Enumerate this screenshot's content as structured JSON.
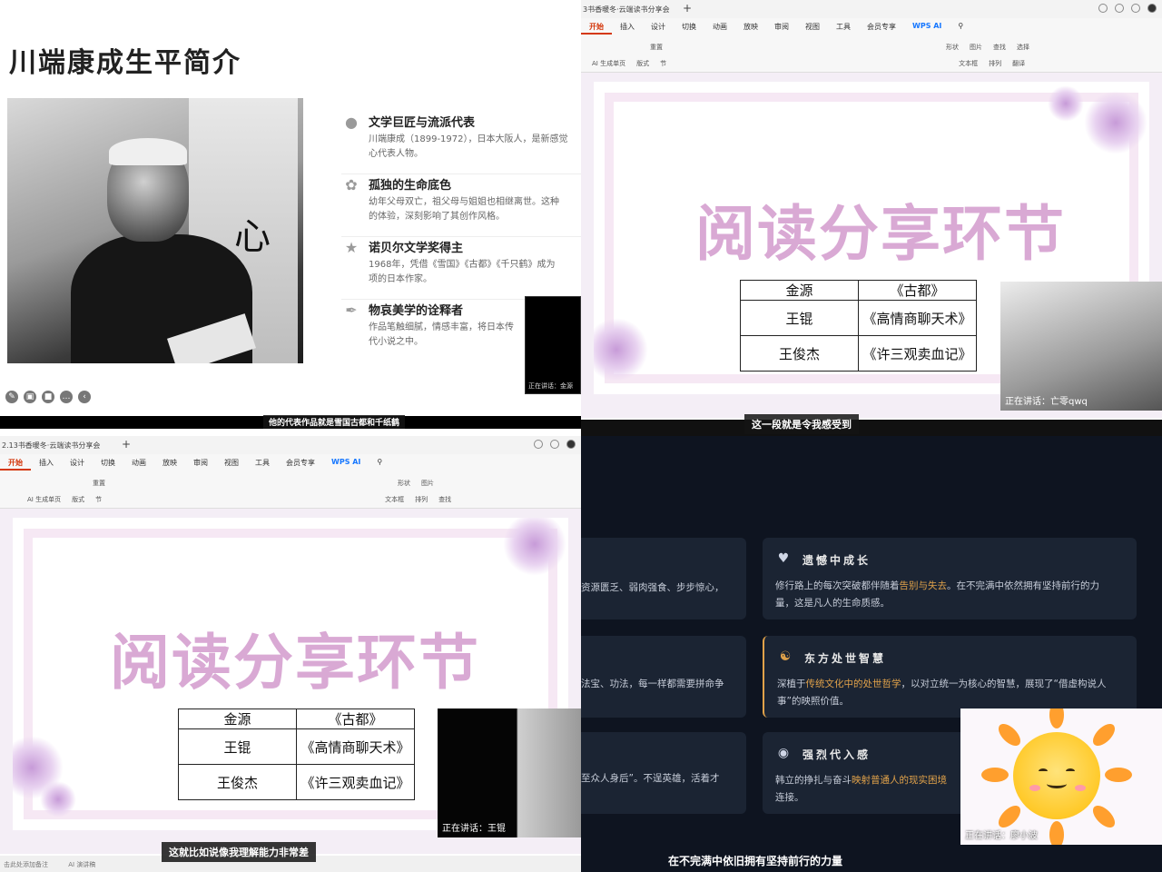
{
  "bio": {
    "title": "川端康成生平简介",
    "portrait_glyph": "心",
    "items": [
      {
        "icon": "person-icon",
        "heading": "文学巨匠与流派代表",
        "text": "川端康成（1899-1972），日本大阪人，是新感觉",
        "text2": "心代表人物。"
      },
      {
        "icon": "leaf-icon",
        "heading": "孤独的生命底色",
        "text": "幼年父母双亡，祖父母与姐姐也相继离世。这种",
        "text2": "的体验，深刻影响了其创作风格。"
      },
      {
        "icon": "trophy-icon",
        "heading": "诺贝尔文学奖得主",
        "text": "1968年，凭借《雪国》《古都》《千只鹤》成为",
        "text2": "项的日本作家。"
      },
      {
        "icon": "feather-icon",
        "heading": "物哀美学的诠释者",
        "text": "作品笔触细腻，情感丰富，将日本传",
        "text2": "代小说之中。"
      }
    ],
    "speaking_label": "正在讲话：金源",
    "subtitle": "他的代表作品就是雪国古都和千纸鹤"
  },
  "wps_top": {
    "doc_tab": "3书香暖冬·云端读书分享会",
    "speaking_label": "正在讲话：亡零qwq",
    "subtitle": "这一段就是令我感受到"
  },
  "wps_bottom": {
    "doc_tab": "2.13书香暖冬·云端读书分享会",
    "speaking_label": "正在讲话：王锟",
    "subtitle": "这就比如说像我理解能力非常差",
    "status_left": "击此处添加备注",
    "status_ai": "AI 演讲稿"
  },
  "menu": [
    "开始",
    "插入",
    "设计",
    "切换",
    "动画",
    "放映",
    "审阅",
    "视图",
    "工具",
    "会员专享",
    "WPS AI"
  ],
  "ribbon": {
    "row1": [
      "重置",
      "形状",
      "图片",
      "查找",
      "选择"
    ],
    "row2": [
      "AI 生成单页",
      "版式",
      "节",
      "文本框",
      "排列",
      "翻译"
    ]
  },
  "share_slide": {
    "title": "阅读分享环节",
    "rows": [
      [
        "金源",
        "《古都》"
      ],
      [
        "王锟",
        "《高情商聊天术》"
      ],
      [
        "王俊杰",
        "《许三观卖血记》"
      ]
    ]
  },
  "dark": {
    "left_fragments": [
      "资源匮乏、弱肉强食、步步惊心，",
      "法宝、功法，每一样都需要拼命争",
      "至众人身后”。不逞英雄，活着才"
    ],
    "cards": [
      {
        "icon": "heart-icon",
        "title": "遗憾中成长",
        "line1_a": "修行路上的每次突破都伴随着",
        "line1_hl": "告别与失去",
        "line1_b": "。在不完满中依然拥有坚持前行的力",
        "line2": "量，这是凡人的生命质感。"
      },
      {
        "icon": "yin-yang-icon",
        "title": "东方处世智慧",
        "line1_a": "深植于",
        "line1_hl": "传统文化中的处世哲学",
        "line1_b": "，以对立统一为核心的智慧，展现了“借虚构说人",
        "line2": "事”的映照价值。"
      },
      {
        "icon": "people-icon",
        "title": "强烈代入感",
        "line1_a": "韩立的挣扎与奋斗",
        "line1_hl": "映射普通人的现实困境",
        "line1_b": "",
        "line2": "连接。"
      }
    ],
    "speaking_label": "正在讲话：廖小波",
    "subtitle": "在不完满中依旧拥有坚持前行的力量"
  },
  "colors": {
    "accent_red": "#d4380d",
    "title_pink": "#d9a9d4",
    "dark_bg": "#0e1420",
    "card_bg": "#1b2433",
    "highlight": "#e1a24a"
  }
}
